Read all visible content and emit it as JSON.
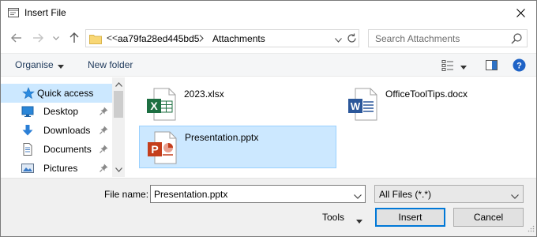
{
  "window": {
    "title": "Insert File"
  },
  "navigation": {
    "address": {
      "overflow": "<<",
      "segments": [
        "aa79fa28ed445bd5",
        "Attachments"
      ]
    },
    "search": {
      "placeholder": "Search Attachments"
    }
  },
  "commandbar": {
    "organise_label": "Organise",
    "new_folder_label": "New folder"
  },
  "sidebar": {
    "items": [
      {
        "label": "Quick access",
        "icon": "star-icon",
        "selected": true
      },
      {
        "label": "Desktop",
        "icon": "desktop-icon",
        "pinned": true
      },
      {
        "label": "Downloads",
        "icon": "download-icon",
        "pinned": true
      },
      {
        "label": "Documents",
        "icon": "documents-icon",
        "pinned": true
      },
      {
        "label": "Pictures",
        "icon": "pictures-icon",
        "pinned": true
      }
    ]
  },
  "files": [
    {
      "name": "2023.xlsx",
      "icon": "excel-icon",
      "selected": false
    },
    {
      "name": "OfficeToolTips.docx",
      "icon": "word-icon",
      "selected": false
    },
    {
      "name": "Presentation.pptx",
      "icon": "powerpoint-icon",
      "selected": true
    }
  ],
  "bottom": {
    "file_name_label": "File name:",
    "file_name_value": "Presentation.pptx",
    "file_type_value": "All Files (*.*)",
    "tools_label": "Tools",
    "insert_label": "Insert",
    "cancel_label": "Cancel"
  },
  "colors": {
    "accent": "#0078d7",
    "selection": "#cce8ff",
    "excel": "#1d6f42",
    "word": "#2b579a",
    "powerpoint": "#c43e1c"
  }
}
